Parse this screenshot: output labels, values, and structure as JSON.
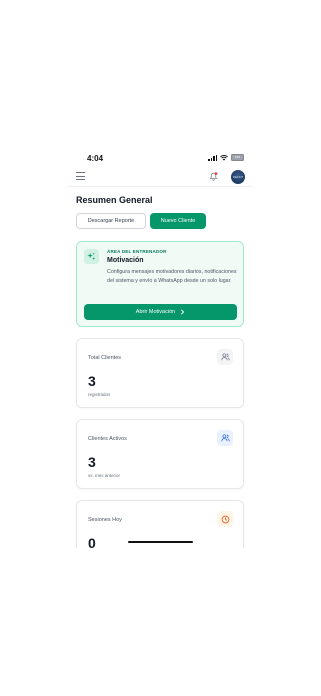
{
  "status_bar": {
    "time": "4:04",
    "battery": "100"
  },
  "header": {
    "avatar_text": "DEFFIT"
  },
  "page": {
    "title": "Resumen General"
  },
  "actions": {
    "download_label": "Descargar Reporte",
    "new_client_label": "Nuevo Cliente"
  },
  "motivation": {
    "eyebrow": "ÁREA DEL ENTRENADOR",
    "title": "Motivación",
    "description": "Configura mensajes motivadores diarios, notificaciones del sistema y envío a WhatsApp desde un solo lugar.",
    "button_label": "Abrir Motivación",
    "button_icon": "chevron-right-icon"
  },
  "stats": [
    {
      "label": "Total Clientes",
      "value": "3",
      "sub": "registrados",
      "icon": "users-icon",
      "icon_color": "#6b7280",
      "icon_bg": "#f3f4f6"
    },
    {
      "label": "Clientes Activos",
      "value": "3",
      "sub": "vs. mes anterior",
      "icon": "users-icon",
      "icon_color": "#2563eb",
      "icon_bg": "#eaf1fe"
    },
    {
      "label": "Sesiones Hoy",
      "value": "0",
      "sub": "",
      "icon": "clock-icon",
      "icon_color": "#ea580c",
      "icon_bg": "#fff4e8"
    }
  ],
  "colors": {
    "primary": "#059669",
    "accent_light": "#f0fbf6",
    "notification_dot": "#ef4444"
  }
}
